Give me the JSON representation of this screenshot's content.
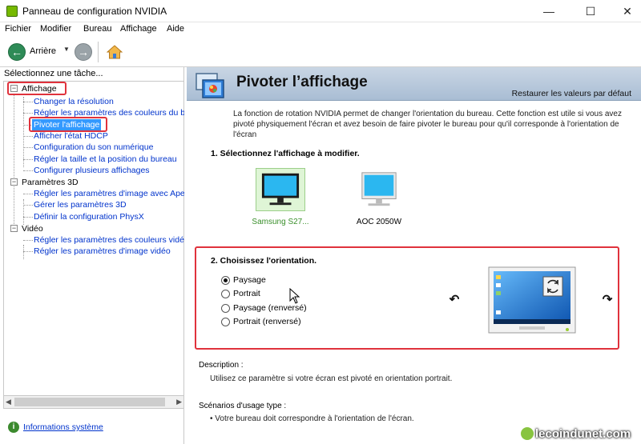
{
  "window": {
    "title": "Panneau de configuration NVIDIA",
    "minimize": "—",
    "maximize": "☐",
    "close": "✕"
  },
  "menu": [
    "Fichier",
    "Modifier",
    "Bureau",
    "Affichage",
    "Aide"
  ],
  "toolbar": {
    "back_label": "Arrière"
  },
  "left": {
    "task_label": "Sélectionnez une tâche...",
    "tree": [
      {
        "type": "group",
        "label": "Affichage"
      },
      {
        "type": "link",
        "label": "Changer la résolution"
      },
      {
        "type": "link",
        "label": "Régler les paramètres des couleurs du bureau"
      },
      {
        "type": "link",
        "label": "Pivoter l'affichage",
        "selected": true
      },
      {
        "type": "link",
        "label": "Afficher l'état HDCP"
      },
      {
        "type": "link",
        "label": "Configuration du son numérique"
      },
      {
        "type": "link",
        "label": "Régler la taille et la position du bureau"
      },
      {
        "type": "link",
        "label": "Configurer plusieurs affichages"
      },
      {
        "type": "group",
        "label": "Paramètres 3D"
      },
      {
        "type": "link",
        "label": "Régler les paramètres d'image avec Aperçu"
      },
      {
        "type": "link",
        "label": "Gérer les paramètres 3D"
      },
      {
        "type": "link",
        "label": "Définir la configuration PhysX"
      },
      {
        "type": "group",
        "label": "Vidéo"
      },
      {
        "type": "link",
        "label": "Régler les paramètres des couleurs vidéo"
      },
      {
        "type": "link",
        "label": "Régler les paramètres d'image vidéo"
      }
    ],
    "system_info": "Informations système"
  },
  "right": {
    "title": "Pivoter l’affichage",
    "restore": "Restaurer les valeurs par défaut",
    "intro": "La fonction de rotation NVIDIA permet de changer l'orientation du bureau. Cette fonction est utile si vous avez pivoté physiquement l'écran et avez besoin de faire pivoter le bureau pour qu'il corresponde à l'orientation de l'écran",
    "section1": {
      "title": "1. Sélectionnez l'affichage à modifier.",
      "displays": [
        {
          "label": "Samsung S27...",
          "selected": true
        },
        {
          "label": "AOC 2050W",
          "selected": false
        }
      ]
    },
    "section2": {
      "title": "2. Choisissez l'orientation.",
      "options": [
        {
          "label": "Paysage",
          "checked": true
        },
        {
          "label": "Portrait",
          "checked": false
        },
        {
          "label": "Paysage (renversé)",
          "checked": false
        },
        {
          "label": "Portrait (renversé)",
          "checked": false
        }
      ],
      "rotate_left": "↶",
      "rotate_right": "↷"
    },
    "description": {
      "title": "Description :",
      "body": "Utilisez ce paramètre si votre écran est pivoté en orientation portrait."
    },
    "scenarios": {
      "title": "Scénarios d'usage type :",
      "body": "• Votre bureau doit correspondre à l'orientation de l'écran."
    }
  },
  "watermark": "lecoindunet.com",
  "colors": {
    "accent_red": "#e0323c",
    "selection": "#3399ff",
    "link": "#0033cc",
    "nvidia_green": "#76b900"
  }
}
